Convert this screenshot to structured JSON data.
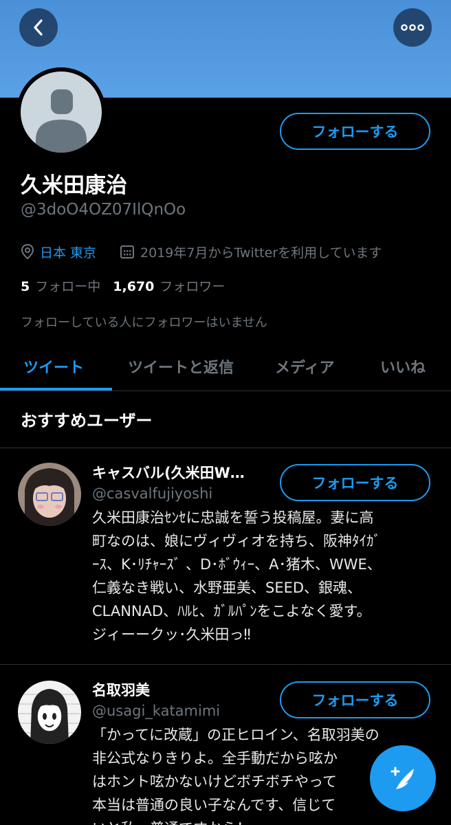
{
  "header": {
    "back_icon": "chevron-left-icon",
    "more_icon": "more-horizontal-icon"
  },
  "profile": {
    "follow_label": "フォローする",
    "name": "久米田康治",
    "handle": "@3doO4OZ07IlQnOo",
    "location": "日本 東京",
    "joined": "2019年7月からTwitterを利用しています",
    "following_count": "5",
    "following_label": "フォロー中",
    "followers_count": "1,670",
    "followers_label": "フォロワー",
    "notice": "フォローしている人にフォロワーはいません"
  },
  "tabs": [
    {
      "label": "ツイート",
      "active": true
    },
    {
      "label": "ツイートと返信",
      "active": false
    },
    {
      "label": "メディア",
      "active": false
    },
    {
      "label": "いいね",
      "active": false
    }
  ],
  "recommended": {
    "title": "おすすめユーザー",
    "users": [
      {
        "name": "キャスバル(久米田W…",
        "handle": "@casvalfujiyoshi",
        "follow_label": "フォローする",
        "bio": "久米田康治ｾﾝｾに忠誠を誓う投稿屋。妻に高\n町なのは、娘にヴィヴィオを持ち、阪神ﾀｲｶﾞ\nｰｽ、K･ﾘﾁｬｰｽﾞ 、D･ﾎﾞｳｨｰ、A･猪木、WWE、\n仁義なき戦い、水野亜美、SEED、銀魂、\nCLANNAD、ﾊﾙﾋ、ｶﾞﾙﾊﾟﾝをこよなく愛す。\nジィーークッ･久米田っ‼"
      },
      {
        "name": "名取羽美",
        "handle": "@usagi_katamimi",
        "follow_label": "フォローする",
        "bio": "「かってに改蔵」の正ヒロイン、名取羽美の\n非公式なりきりよ。全手動だから呟か\nはホント呟かないけどボチボチやって\n本当は普通の良い子なんです、信じて\nいと私、普通ですから！"
      }
    ]
  },
  "colors": {
    "accent": "#1d9bf0",
    "banner": "#4a90d8",
    "muted": "#6e767d"
  },
  "fab_icon": "compose-tweet-icon"
}
